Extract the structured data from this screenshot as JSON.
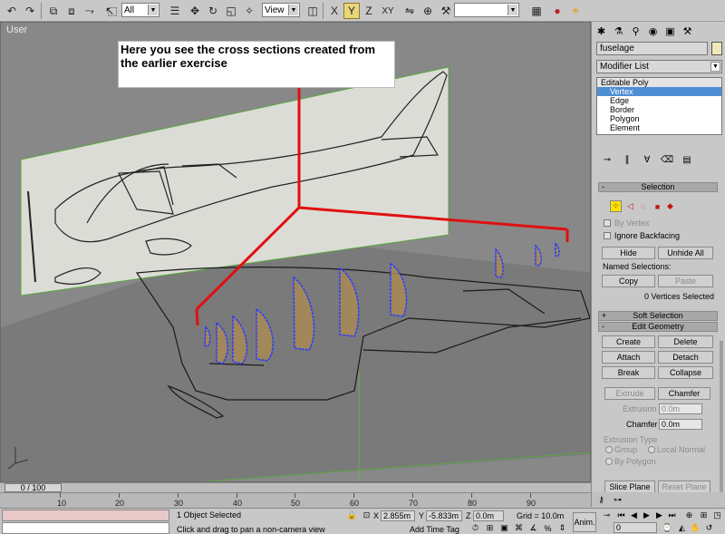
{
  "toolbar": {
    "selection_filter": "All",
    "reference_coord": "View",
    "named_selection": ""
  },
  "viewport": {
    "label": "User",
    "callout": "Here you see the cross sections created from the earlier exercise"
  },
  "command_panel": {
    "object_name": "fuselage",
    "modifier_list": "Modifier List",
    "stack": [
      "Editable Poly",
      "Vertex",
      "Edge",
      "Border",
      "Polygon",
      "Element"
    ],
    "selection": {
      "title": "Selection",
      "by_vertex": "By Vertex",
      "ignore_backfacing": "Ignore Backfacing",
      "hide": "Hide",
      "unhide_all": "Unhide All",
      "named_selections": "Named Selections:",
      "copy": "Copy",
      "paste": "Paste",
      "count": "0 Vertices Selected"
    },
    "soft_selection": {
      "title": "Soft Selection"
    },
    "edit_geometry": {
      "title": "Edit Geometry",
      "create": "Create",
      "delete": "Delete",
      "attach": "Attach",
      "detach": "Detach",
      "break": "Break",
      "collapse": "Collapse",
      "extrude": "Extrude",
      "chamfer": "Chamfer",
      "extrusion_label": "Extrusion",
      "extrusion_value": "0.0m",
      "chamfer_label": "Chamfer",
      "chamfer_value": "0.0m",
      "extrude_type": "Extrusion Type",
      "group": "Group",
      "local_normal": "Local Normal",
      "by_polygon": "By Polygon",
      "slice_plane": "Slice Plane",
      "reset_plane": "Reset Plane"
    }
  },
  "timeline": {
    "frame": "0 / 100",
    "ticks": [
      "10",
      "20",
      "30",
      "40",
      "50",
      "60",
      "70",
      "80",
      "90"
    ]
  },
  "status": {
    "selected": "1 Object Selected",
    "prompt": "Click and drag to pan a non-camera view",
    "x_label": "X",
    "x": "2.855m",
    "y_label": "Y",
    "y": "-5.833m",
    "z_label": "Z",
    "z": "0.0m",
    "grid": "Grid = 10.0m",
    "add_time_tag": "Add Time Tag",
    "anim": "Anim.",
    "frame_field": "0"
  }
}
